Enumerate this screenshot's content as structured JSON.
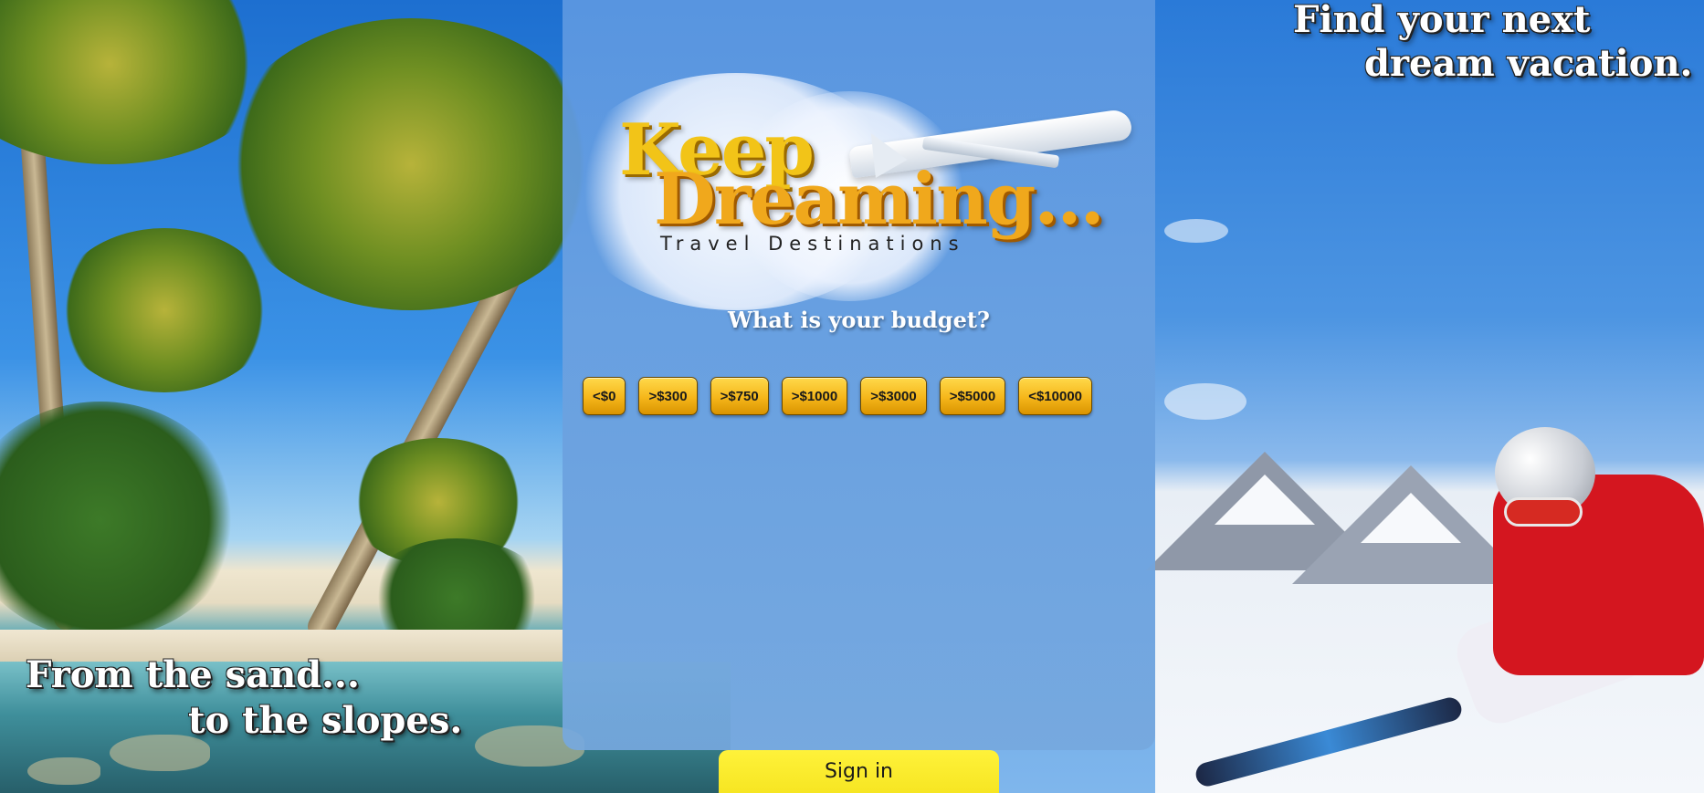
{
  "taglines": {
    "top_line1": "Find your next",
    "top_line2": "dream vacation.",
    "bottom_line1": "From the sand...",
    "bottom_line2": "to the slopes."
  },
  "logo": {
    "word1": "Keep",
    "word2": "Dreaming...",
    "subtitle": "Travel Destinations"
  },
  "budget": {
    "question": "What is your budget?",
    "options": [
      "<$0",
      ">$300",
      ">$750",
      ">$1000",
      ">$3000",
      ">$5000",
      "<$10000"
    ]
  },
  "signin": {
    "label": "Sign in"
  },
  "colors": {
    "button_gold": "#f5b61a",
    "signin_yellow": "#f4e21c",
    "panel_blue": "#6aa0e1"
  }
}
